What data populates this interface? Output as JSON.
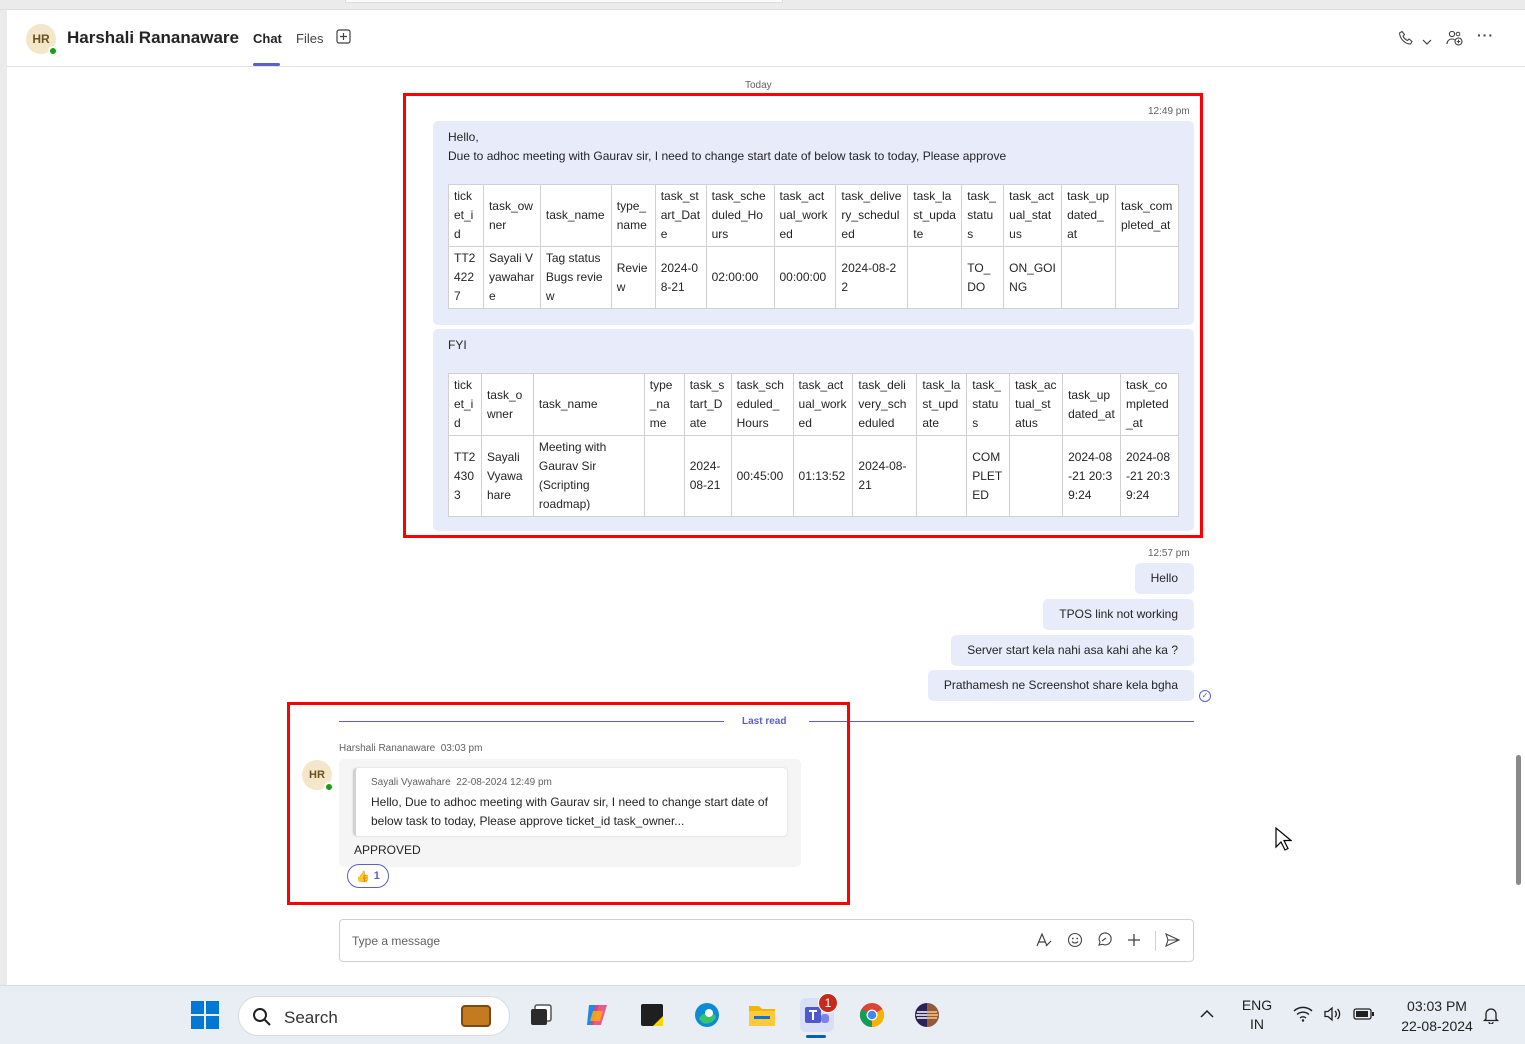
{
  "header": {
    "avatar_initials": "HR",
    "contact_name": "Harshali Rananaware",
    "tabs": [
      {
        "label": "Chat",
        "active": true
      },
      {
        "label": "Files",
        "active": false
      }
    ]
  },
  "chat": {
    "day_divider": "Today",
    "first_group_time": "12:49 pm",
    "message1": {
      "line1": "Hello,",
      "line2": "Due to adhoc meeting with Gaurav sir, I need to change start date of below task to today, Please approve",
      "table_headers": [
        "ticket_id",
        "task_owner",
        "task_name",
        "type_name",
        "task_start_Date",
        "task_scheduled_Hours",
        "task_actual_worked",
        "task_delivery_scheduled",
        "task_last_update",
        "task_status",
        "task_actual_status",
        "task_updated_at",
        "task_completed_at"
      ],
      "table_row": [
        "TT24227",
        "Sayali Vyawahare",
        "Tag status Bugs review",
        "Review",
        "2024-08-21",
        "02:00:00",
        "00:00:00",
        "2024-08-22",
        "",
        "TO_DO",
        "ON_GOING",
        "",
        ""
      ]
    },
    "message2": {
      "line1": "FYI",
      "table_headers": [
        "ticket_id",
        "task_owner",
        "task_name",
        "type_name",
        "task_start_Date",
        "task_scheduled_Hours",
        "task_actual_worked",
        "task_delivery_scheduled",
        "task_last_update",
        "task_status",
        "task_actual_status",
        "task_updated_at",
        "task_completed_at"
      ],
      "table_row": [
        "TT24303",
        "Sayali Vyawahare",
        "Meeting with Gaurav Sir (Scripting roadmap)",
        "",
        "2024-08-21",
        "00:45:00",
        "01:13:52",
        "2024-08-21",
        "",
        "COMPLETED",
        "",
        "2024-08-21 20:39:24",
        "2024-08-21 20:39:24"
      ]
    },
    "second_group_time": "12:57 pm",
    "short_messages": [
      "Hello",
      "TPOS link not working",
      "Server start kela nahi asa kahi ahe ka ?",
      "Prathamesh ne Screenshot share kela bgha"
    ],
    "last_read_label": "Last read",
    "incoming": {
      "sender": "Harshali Rananaware",
      "time": "03:03 pm",
      "avatar_initials": "HR",
      "quote_author": "Sayali Vyawahare",
      "quote_time": "22-08-2024 12:49 pm",
      "quote_text": "Hello, Due to adhoc meeting with Gaurav sir, I need to change start date of below task to today, Please approve ticket_id task_owner...",
      "body": "APPROVED",
      "reaction_emoji": "👍",
      "reaction_count": "1"
    }
  },
  "composer": {
    "placeholder": "Type a message"
  },
  "taskbar": {
    "search_label": "Search",
    "teams_badge": "1",
    "lang_line1": "ENG",
    "lang_line2": "IN",
    "clock_time": "03:03 PM",
    "clock_date": "22-08-2024"
  },
  "colors": {
    "accent": "#5b5fc7",
    "own_bubble": "#e8ebfa",
    "highlight_box": "#ff0000"
  }
}
